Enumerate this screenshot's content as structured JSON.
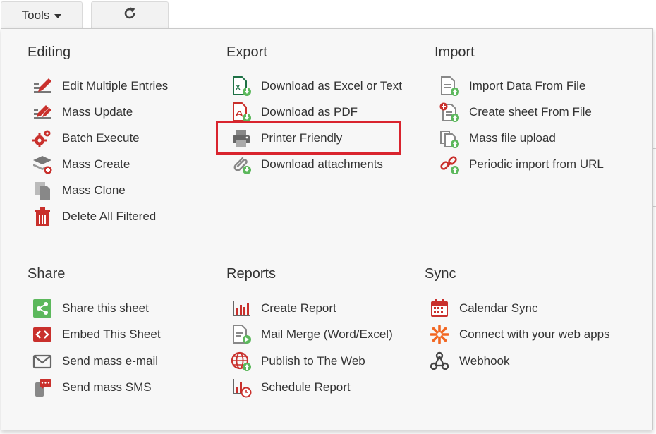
{
  "toolbar": {
    "tools_label": "Tools",
    "tools_icon": "caret-down-icon",
    "refresh_icon": "refresh-icon"
  },
  "sections": {
    "editing": {
      "title": "Editing",
      "items": [
        {
          "label": "Edit Multiple Entries",
          "icon": "edit-multiple-icon"
        },
        {
          "label": "Mass Update",
          "icon": "mass-update-icon"
        },
        {
          "label": "Batch Execute",
          "icon": "gears-icon"
        },
        {
          "label": "Mass Create",
          "icon": "layers-add-icon"
        },
        {
          "label": "Mass Clone",
          "icon": "copy-icon"
        },
        {
          "label": "Delete All Filtered",
          "icon": "trash-icon"
        }
      ]
    },
    "export": {
      "title": "Export",
      "items": [
        {
          "label": "Download as Excel or Text",
          "icon": "excel-download-icon"
        },
        {
          "label": "Download as PDF",
          "icon": "pdf-download-icon"
        },
        {
          "label": "Printer Friendly",
          "icon": "printer-icon"
        },
        {
          "label": "Download attachments",
          "icon": "attachment-download-icon"
        }
      ]
    },
    "import": {
      "title": "Import",
      "items": [
        {
          "label": "Import Data From File",
          "icon": "file-import-icon"
        },
        {
          "label": "Create sheet From File",
          "icon": "create-sheet-icon"
        },
        {
          "label": "Mass file upload",
          "icon": "files-upload-icon"
        },
        {
          "label": "Periodic import from URL",
          "icon": "link-import-icon"
        }
      ]
    },
    "share": {
      "title": "Share",
      "items": [
        {
          "label": "Share this sheet",
          "icon": "share-icon"
        },
        {
          "label": "Embed This Sheet",
          "icon": "embed-code-icon"
        },
        {
          "label": "Send mass e-mail",
          "icon": "envelope-icon"
        },
        {
          "label": "Send mass SMS",
          "icon": "sms-icon"
        }
      ]
    },
    "reports": {
      "title": "Reports",
      "items": [
        {
          "label": "Create Report",
          "icon": "bar-chart-icon"
        },
        {
          "label": "Mail Merge (Word/Excel)",
          "icon": "mail-merge-icon"
        },
        {
          "label": "Publish to The Web",
          "icon": "globe-publish-icon"
        },
        {
          "label": "Schedule Report",
          "icon": "schedule-report-icon"
        }
      ]
    },
    "sync": {
      "title": "Sync",
      "items": [
        {
          "label": "Calendar Sync",
          "icon": "calendar-icon"
        },
        {
          "label": "Connect with your web apps",
          "icon": "zapier-asterisk-icon"
        },
        {
          "label": "Webhook",
          "icon": "webhook-icon"
        }
      ]
    }
  },
  "colors": {
    "highlight": "#d9242e",
    "icon_red": "#c9302c",
    "icon_green": "#5cb85c",
    "icon_gray": "#666666"
  }
}
